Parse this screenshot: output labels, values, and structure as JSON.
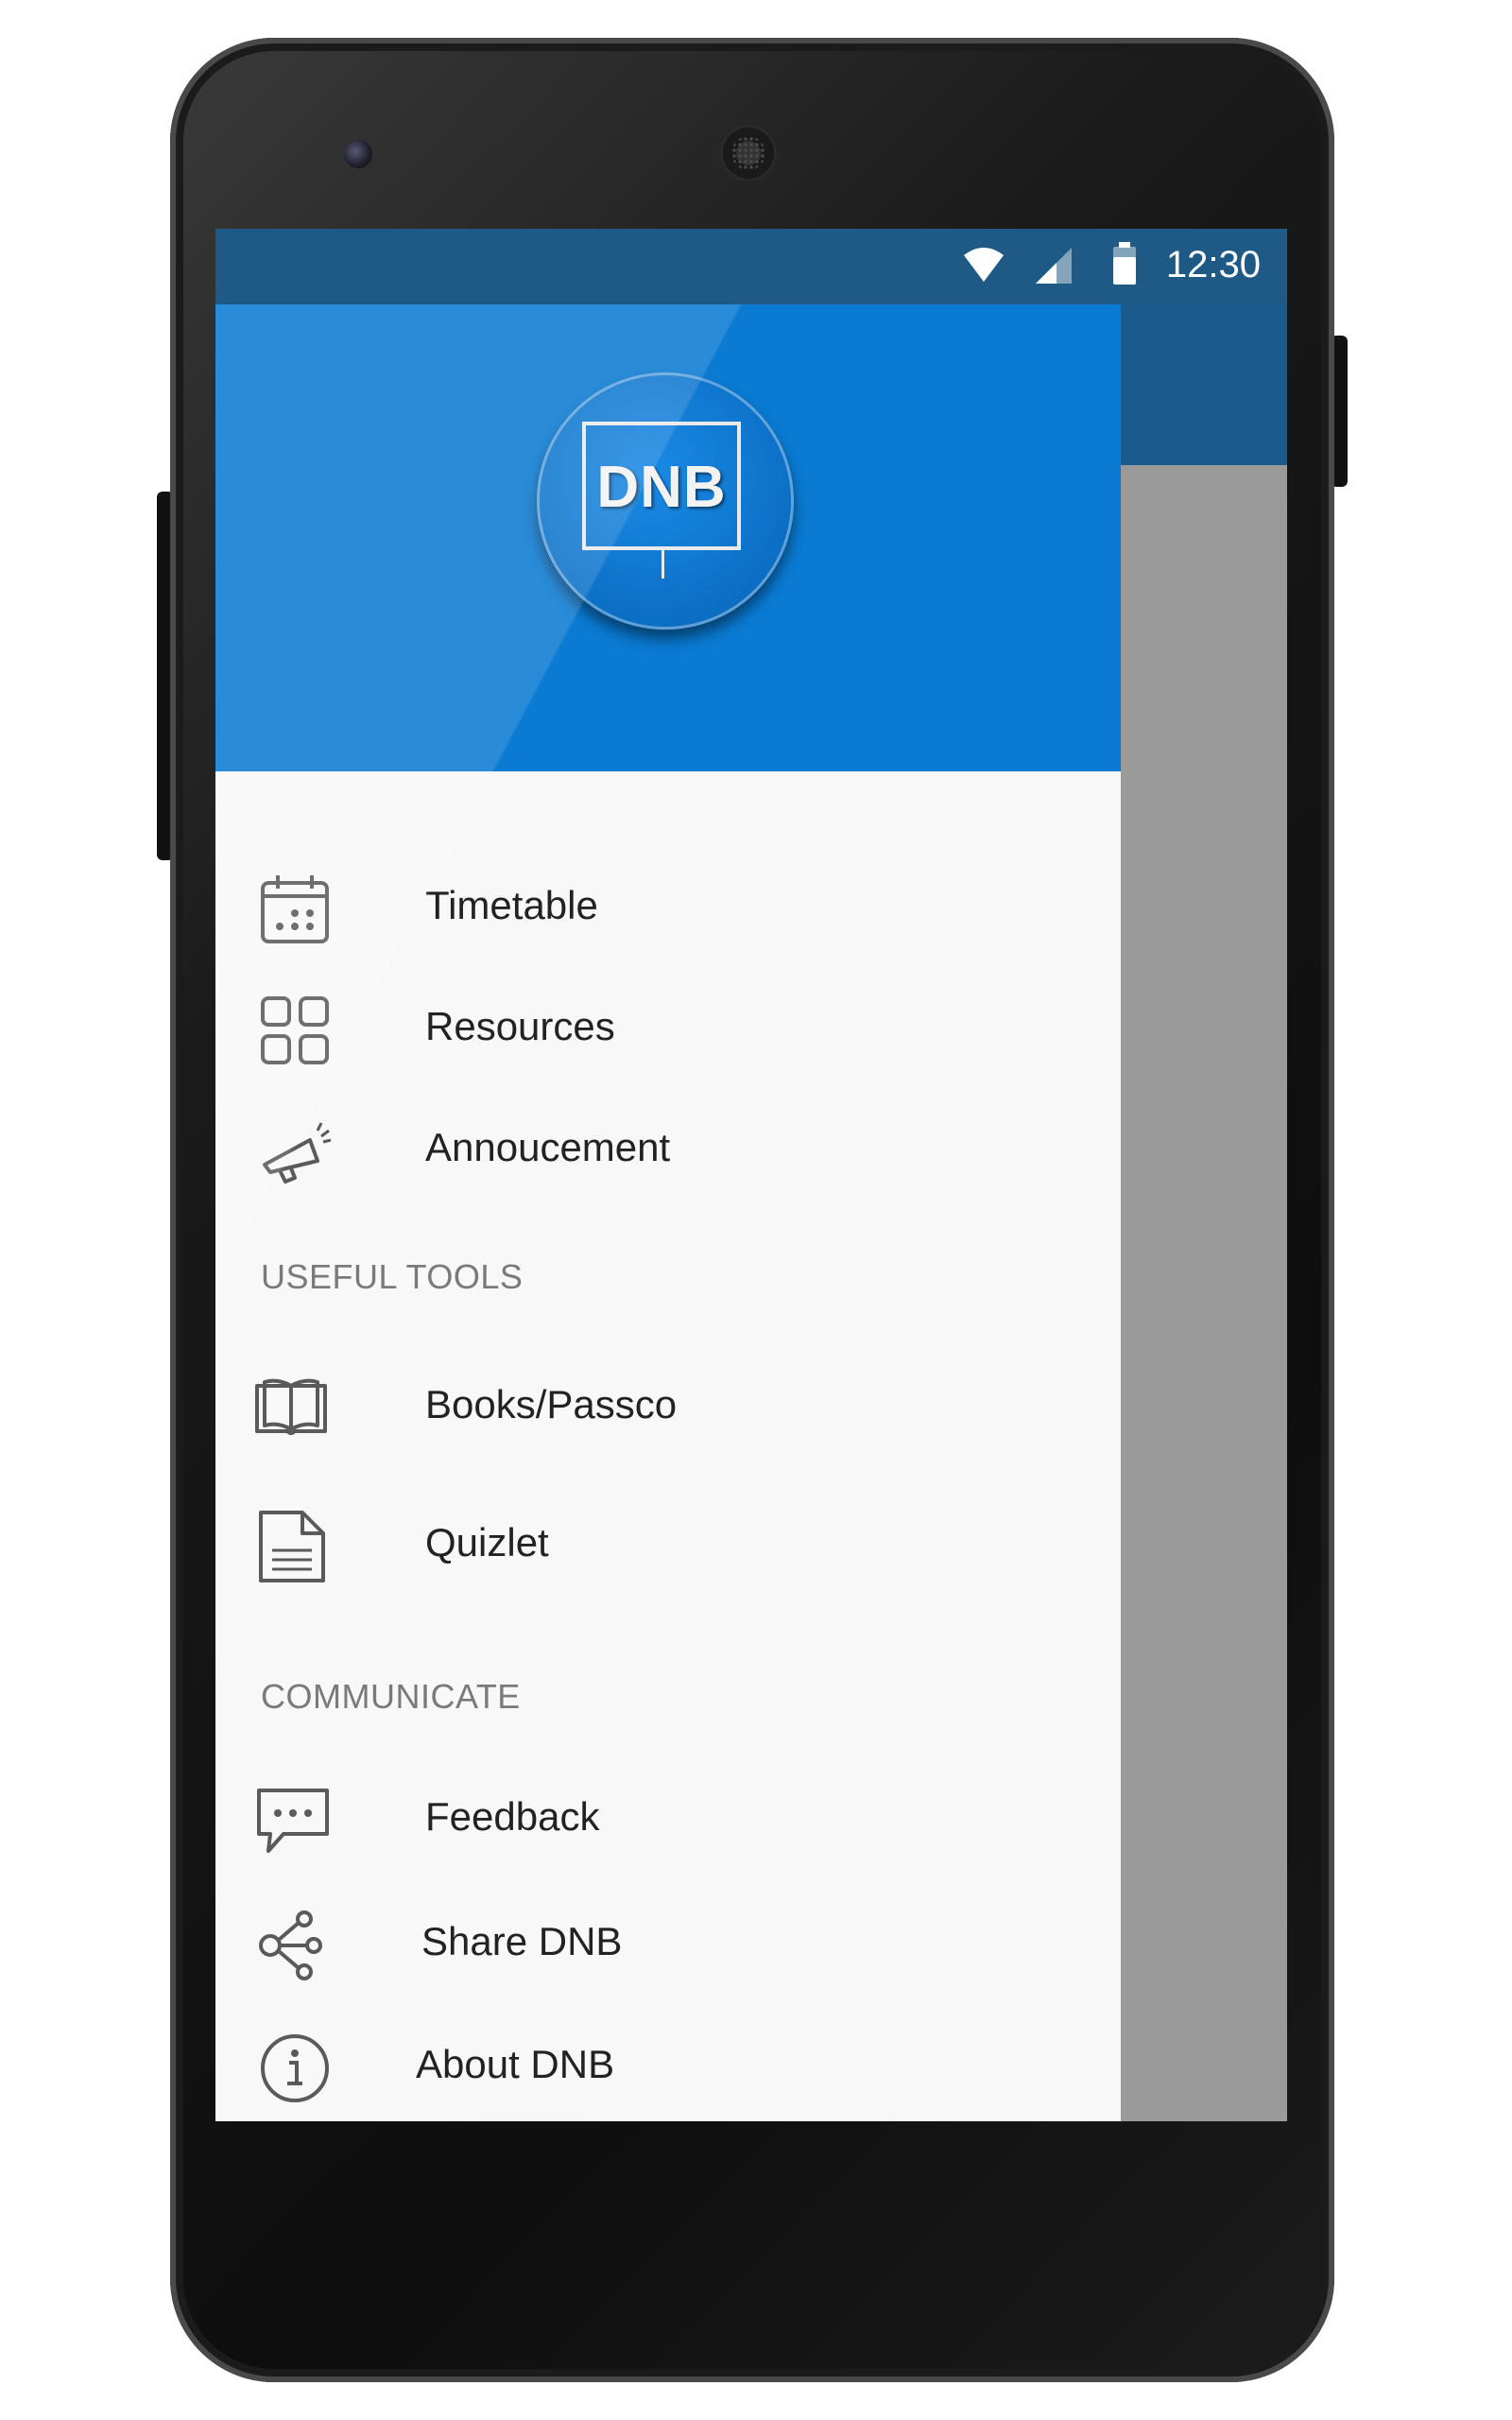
{
  "status_bar": {
    "time": "12:30",
    "icons": [
      "wifi-icon",
      "cellular-signal-icon",
      "battery-icon"
    ]
  },
  "drawer": {
    "header": {
      "logo_text": "DNB",
      "background_color": "#0a7ad2"
    },
    "items": [
      {
        "label": "Timetable",
        "icon": "calendar-icon"
      },
      {
        "label": "Resources",
        "icon": "grid-icon"
      },
      {
        "label": "Annoucement",
        "icon": "megaphone-icon"
      }
    ],
    "sections": [
      {
        "title": "USEFUL TOOLS",
        "items": [
          {
            "label": "Books/Passco",
            "icon": "book-icon"
          },
          {
            "label": "Quizlet",
            "icon": "document-icon"
          }
        ]
      },
      {
        "title": "COMMUNICATE",
        "items": [
          {
            "label": "Feedback",
            "icon": "chat-bubble-icon"
          },
          {
            "label": "Share DNB",
            "icon": "share-icon"
          },
          {
            "label": "About DNB",
            "icon": "info-icon"
          }
        ]
      }
    ]
  },
  "colors": {
    "status_bar": "#1f5a86",
    "toolbar": "#1a5a8c",
    "scrim": "#9a9a9a",
    "drawer_bg": "#f8f8f8"
  }
}
